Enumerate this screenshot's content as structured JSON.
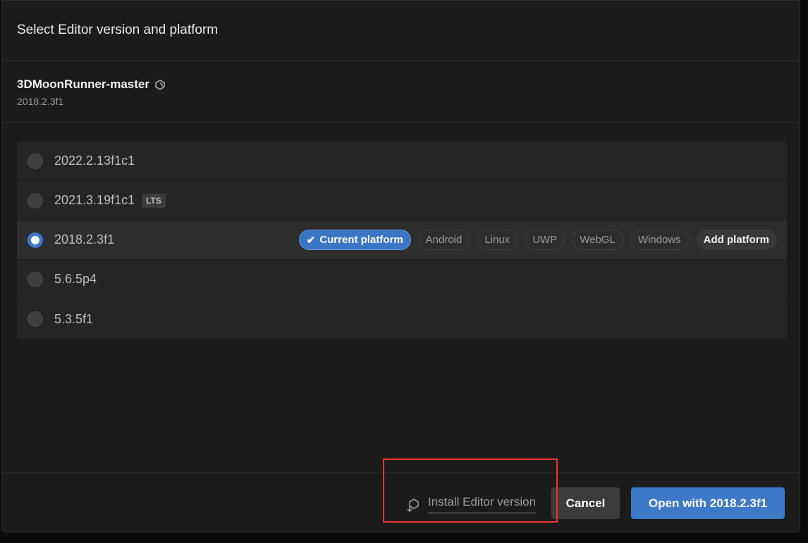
{
  "dialog": {
    "title": "Select Editor version and platform"
  },
  "project": {
    "name": "3DMoonRunner-master",
    "version": "2018.2.3f1",
    "icon": "unity-cube-icon"
  },
  "versions": [
    {
      "label": "2022.2.13f1c1",
      "selected": false
    },
    {
      "label": "2021.3.19f1c1",
      "badge": "LTS",
      "selected": false
    },
    {
      "label": "2018.2.3f1",
      "selected": true
    },
    {
      "label": "5.6.5p4",
      "selected": false
    },
    {
      "label": "5.3.5f1",
      "selected": false
    }
  ],
  "platforms": {
    "current": "Current platform",
    "items": [
      "Android",
      "Linux",
      "UWP",
      "WebGL",
      "Windows"
    ],
    "add": "Add platform"
  },
  "footer": {
    "install": "Install Editor version",
    "cancel": "Cancel",
    "open": "Open with 2018.2.3f1"
  },
  "colors": {
    "accent": "#3d79c6",
    "highlight": "#ee3333"
  }
}
